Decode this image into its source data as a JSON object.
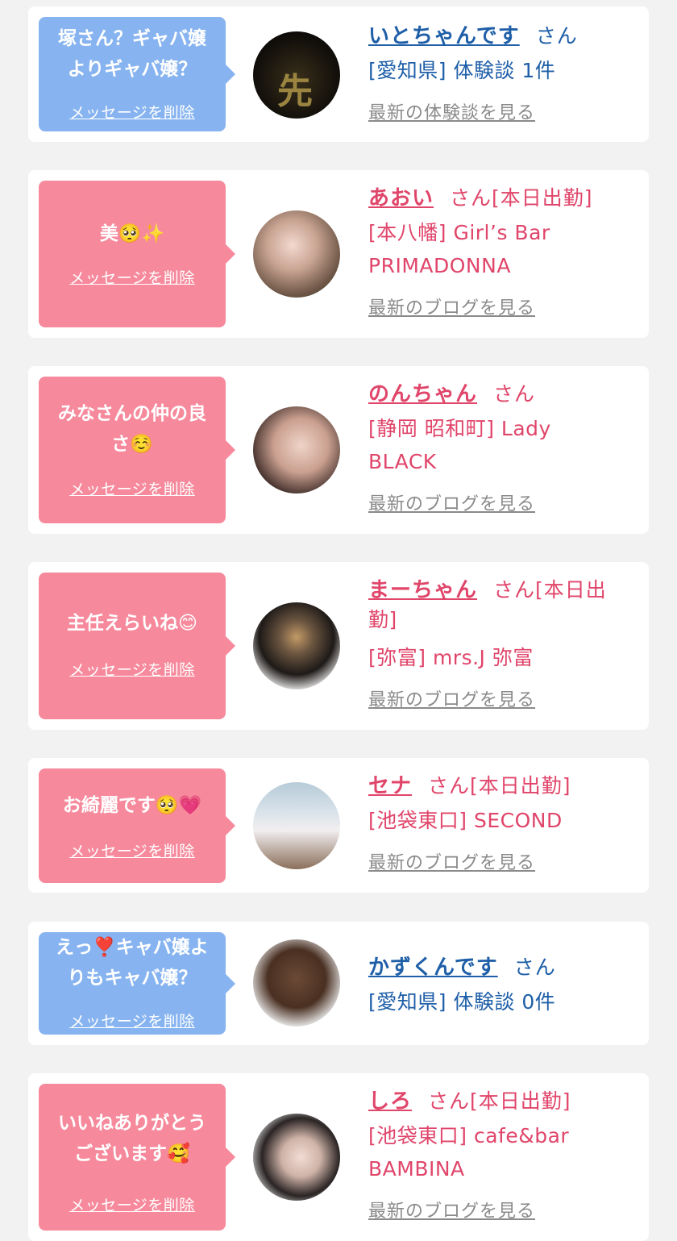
{
  "delete_label": "メッセージを削除",
  "colors": {
    "blue_bubble": "#87b4f0",
    "pink_bubble": "#f68a9c",
    "blue_text": "#1f5fa8",
    "pink_text": "#e0456a"
  },
  "cards": [
    {
      "type": "customer",
      "message_lines": [
        "塚さん？ギャバ嬢",
        "よりギャバ嬢？"
      ],
      "name": "いとちゃんです",
      "suffix": "さん",
      "detail_lines": [
        "[愛知県] 体験談 1件"
      ],
      "more": "最新の体験談を見る",
      "avatar": "dark-avatar-with-kanji"
    },
    {
      "type": "cast",
      "message_lines": [
        "美🥺✨"
      ],
      "name": "あおい",
      "suffix": "さん[本日出勤]",
      "detail_lines": [
        "[本八幡] Girl’s Bar",
        "PRIMADONNA"
      ],
      "more": "最新のブログを見る",
      "avatar": "woman-photo"
    },
    {
      "type": "cast",
      "message_lines": [
        "みなさんの仲の良",
        "さ☺️"
      ],
      "name": "のんちゃん",
      "suffix": "さん",
      "detail_lines": [
        "[静岡 昭和町] Lady",
        "BLACK"
      ],
      "more": "最新のブログを見る",
      "avatar": "woman-photo"
    },
    {
      "type": "cast",
      "message_lines": [
        "主任えらいね😊"
      ],
      "name": "まーちゃん",
      "suffix": "さん[本日出",
      "suffix2": "勤]",
      "detail_lines": [
        "[弥富] mrs.J 弥富"
      ],
      "more": "最新のブログを見る",
      "avatar": "woman-back-photo"
    },
    {
      "type": "cast",
      "message_lines": [
        "お綺麗です🥺💗"
      ],
      "name": "セナ",
      "suffix": "さん[本日出勤]",
      "detail_lines": [
        "[池袋東口] SECOND"
      ],
      "more": "最新のブログを見る",
      "avatar": "outfit-photo"
    },
    {
      "type": "customer",
      "message_lines": [
        "えっ❣️キャバ嬢よ",
        "りもキャバ嬢？"
      ],
      "name": "かずくんです",
      "suffix": "さん",
      "detail_lines": [
        "[愛知県] 体験談 0件"
      ],
      "more": "",
      "avatar": "cartoon-avatar"
    },
    {
      "type": "cast",
      "message_lines": [
        "いいねありがとう",
        "ございます🥰"
      ],
      "name": "しろ",
      "suffix": "さん[本日出勤]",
      "detail_lines": [
        "[池袋東口] cafe&bar",
        "BAMBINA"
      ],
      "more": "最新のブログを見る",
      "avatar": "woman-photo"
    }
  ]
}
